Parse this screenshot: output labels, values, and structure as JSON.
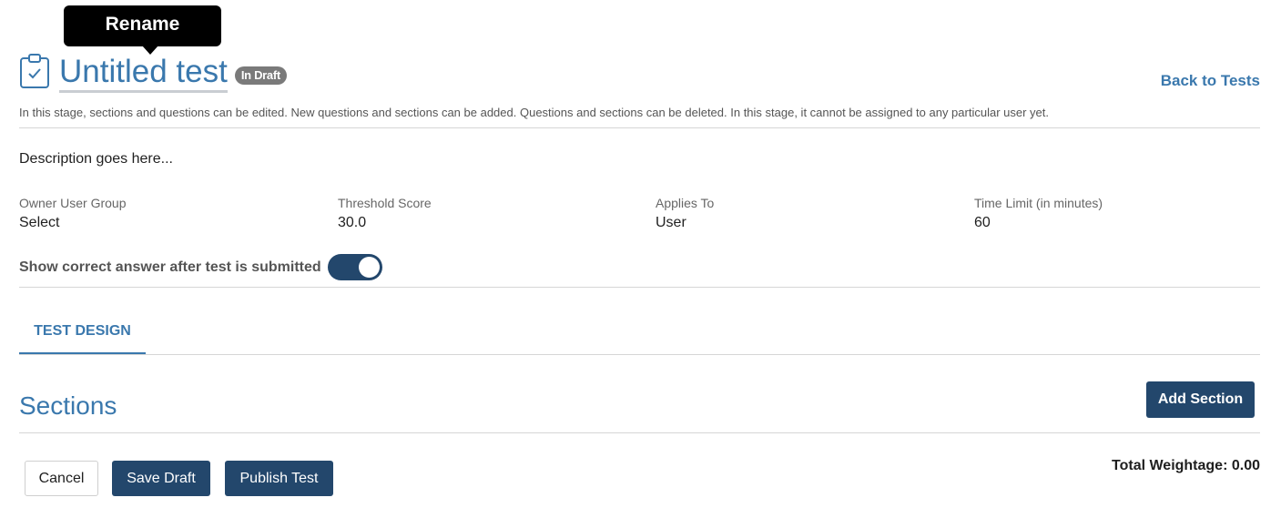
{
  "tooltip": {
    "text": "Rename"
  },
  "header": {
    "title": "Untitled test",
    "status_badge": "In Draft",
    "back_link": "Back to Tests",
    "stage_note": "In this stage, sections and questions can be edited. New questions and sections can be added. Questions and sections can be deleted. In this stage, it cannot be assigned to any particular user yet."
  },
  "description": "Description goes here...",
  "meta": [
    {
      "label": "Owner User Group",
      "value": "Select"
    },
    {
      "label": "Threshold Score",
      "value": "30.0"
    },
    {
      "label": "Applies To",
      "value": "User"
    },
    {
      "label": "Time Limit (in minutes)",
      "value": "60"
    }
  ],
  "show_answer_toggle": {
    "label": "Show correct answer after test is submitted",
    "on": true
  },
  "tabs": [
    {
      "label": "TEST DESIGN",
      "active": true
    }
  ],
  "sections": {
    "heading": "Sections",
    "add_button": "Add Section"
  },
  "footer": {
    "cancel": "Cancel",
    "save_draft": "Save Draft",
    "publish": "Publish Test",
    "total_weightage": "Total Weightage: 0.00"
  },
  "colors": {
    "accent": "#3a78ad",
    "primary_button": "#23476c",
    "badge": "#7a7a7a"
  },
  "icons": {
    "title_icon": "clipboard-check-icon"
  }
}
